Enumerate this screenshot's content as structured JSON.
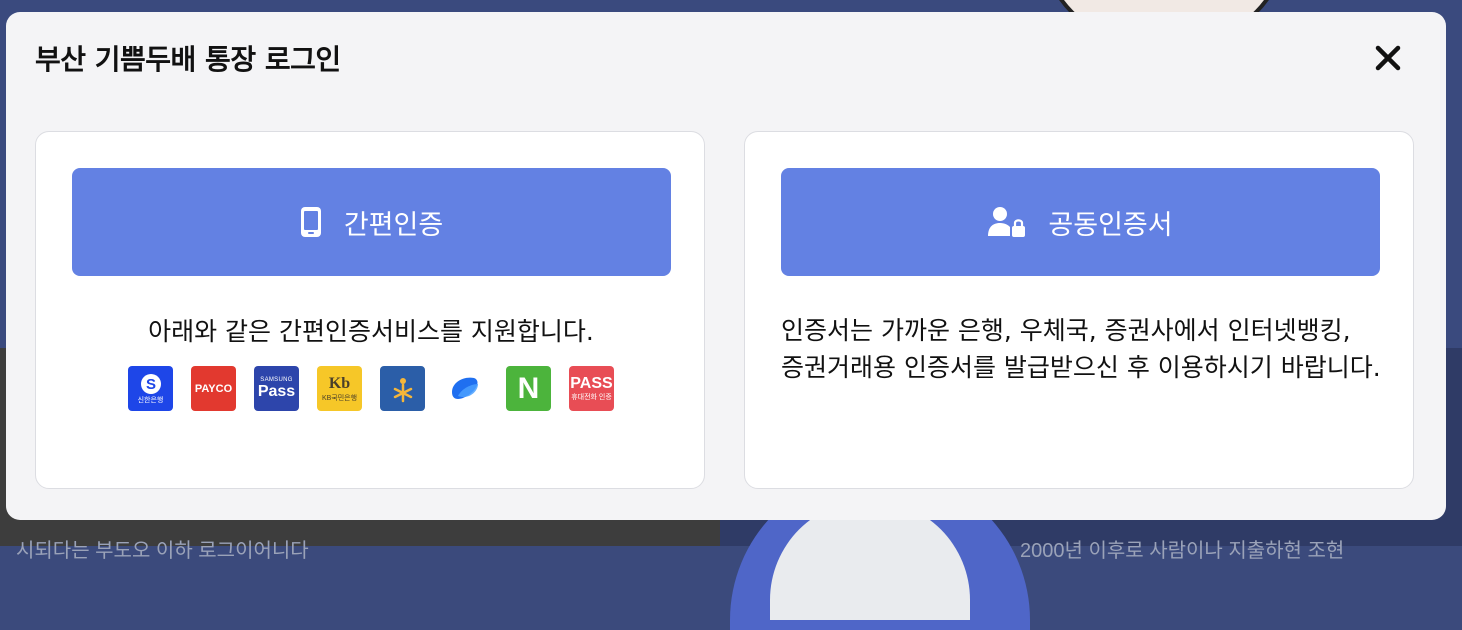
{
  "background": {
    "left_text": "시되다는 부도오 이하 로그이어니다",
    "right_text": "2000년 이후로 사람이나 지출하현 조현"
  },
  "modal": {
    "title": "부산 기쁨두배 통장 로그인",
    "close_icon": "close-icon"
  },
  "simple_auth": {
    "button_label": "간편인증",
    "button_icon": "smartphone-icon",
    "description": "아래와 같은 간편인증서비스를 지원합니다.",
    "providers": [
      {
        "name": "shinhan",
        "label": "신한은행"
      },
      {
        "name": "payco",
        "label": "PAYCO"
      },
      {
        "name": "samsung-pass",
        "top": "SAMSUNG",
        "label": "Pass"
      },
      {
        "name": "kb",
        "top": "Kb",
        "label": "KB국민은행"
      },
      {
        "name": "woori",
        "label": ""
      },
      {
        "name": "toss",
        "label": ""
      },
      {
        "name": "naver",
        "label": "N"
      },
      {
        "name": "pass",
        "top": "PASS",
        "label": "휴대전화 인증"
      }
    ]
  },
  "joint_cert": {
    "button_label": "공동인증서",
    "button_icon": "user-lock-icon",
    "description": "인증서는 가까운 은행, 우체국, 증권사에서 인터넷뱅킹, 증권거래용 인증서를 발급받으신 후 이용하시기 바랍니다."
  },
  "colors": {
    "accent": "#6381e3",
    "modal_bg": "#f4f4f6"
  }
}
